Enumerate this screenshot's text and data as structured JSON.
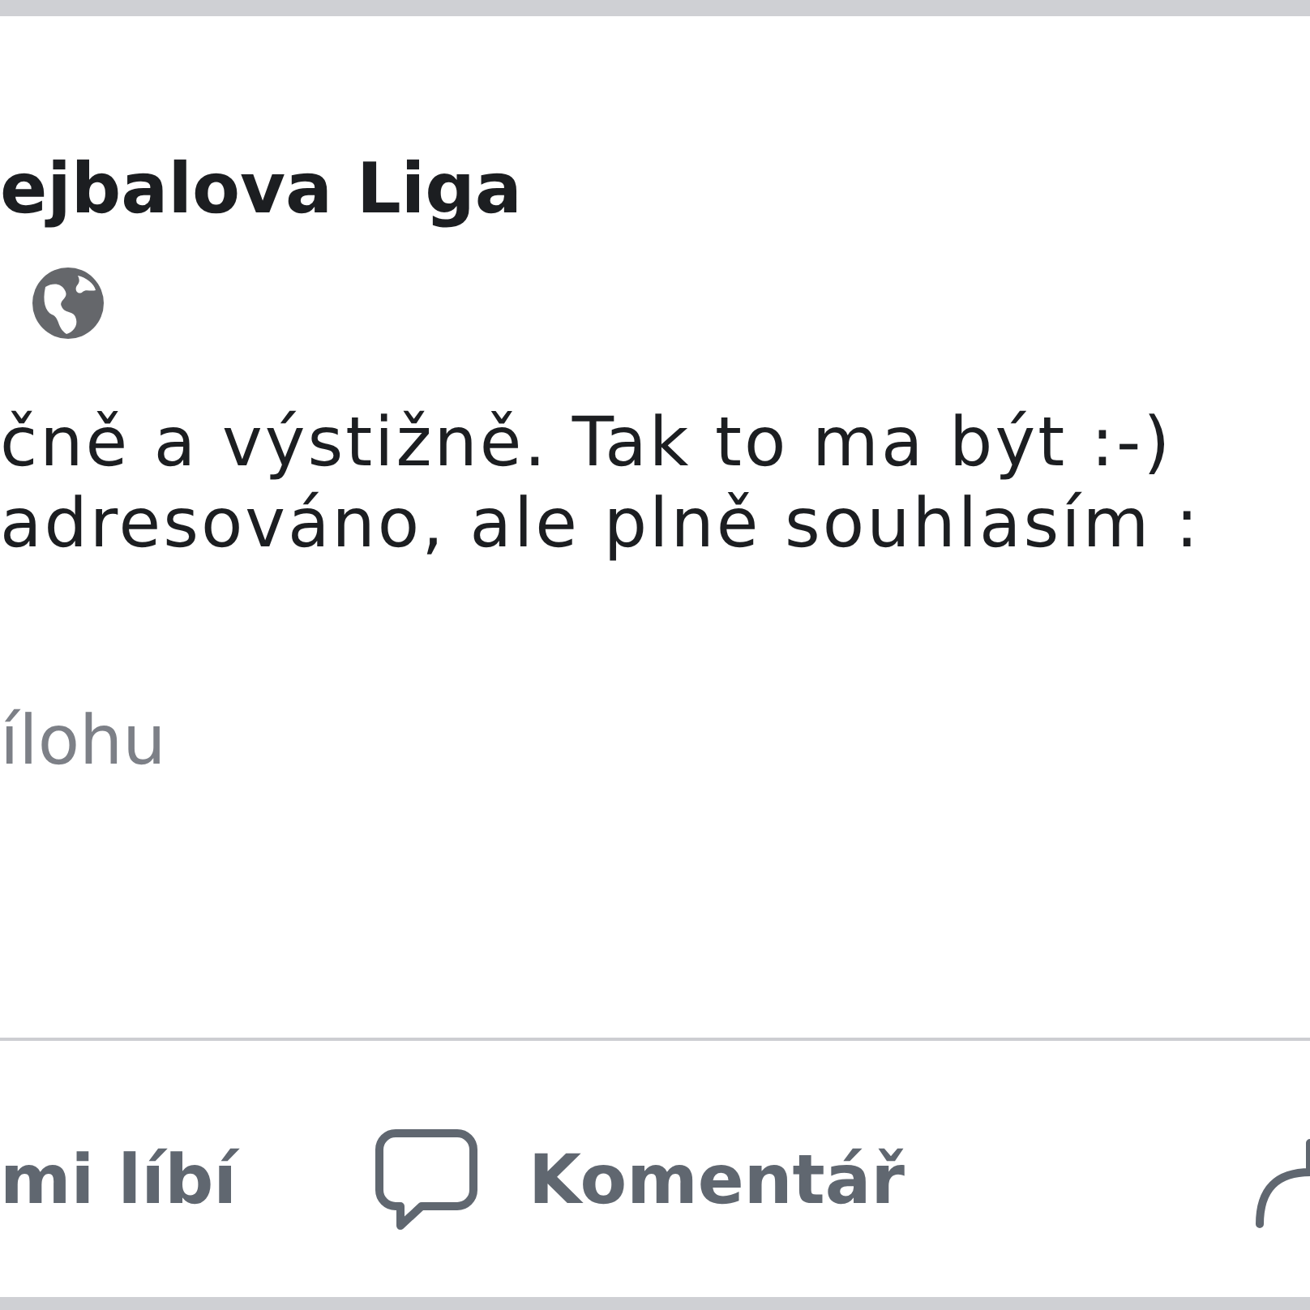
{
  "post": {
    "author": "ejbalova Liga",
    "public": true,
    "body": [
      "čně a výstižně. Tak to ma být :-)",
      "adresováno, ale plně souhlasím :"
    ],
    "attachment_link": "ílohu"
  },
  "actions": [
    {
      "kind": "like",
      "label": "mi líbí"
    },
    {
      "kind": "comment",
      "label": "Komentář"
    },
    {
      "kind": "share"
    }
  ]
}
